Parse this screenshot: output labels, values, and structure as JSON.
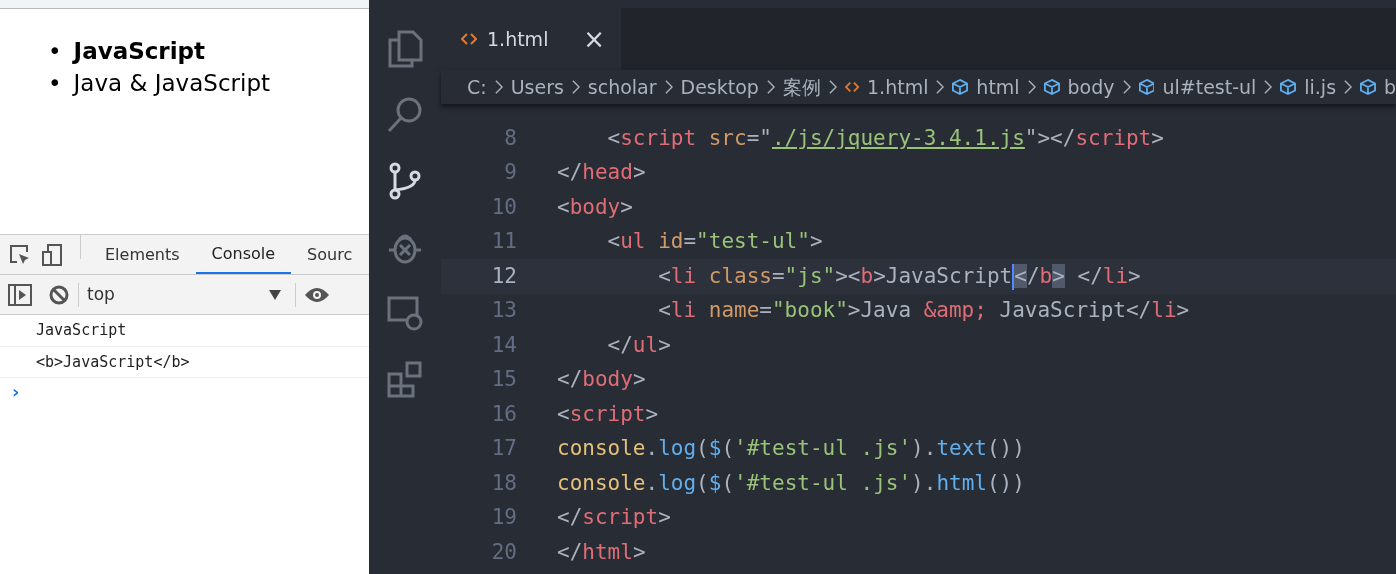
{
  "browser_page": {
    "list_items": [
      {
        "marker": "•",
        "text": "JavaScript",
        "bold": true
      },
      {
        "marker": "•",
        "text": "Java & JavaScript",
        "bold": false
      }
    ]
  },
  "devtools": {
    "tabs": [
      {
        "label": "Elements",
        "selected": false
      },
      {
        "label": "Console",
        "selected": true
      },
      {
        "label": "Sourc",
        "selected": false
      }
    ],
    "context": "top",
    "console_lines": [
      "JavaScript",
      "<b>JavaScript</b>"
    ],
    "prompt": "›"
  },
  "editor": {
    "tabs": [
      {
        "label": "1.html",
        "selected": true,
        "close": "×"
      }
    ],
    "breadcrumbs": [
      {
        "label": "C:",
        "kind": "folder"
      },
      {
        "label": "Users",
        "kind": "folder"
      },
      {
        "label": "scholar",
        "kind": "folder"
      },
      {
        "label": "Desktop",
        "kind": "folder"
      },
      {
        "label": "案例",
        "kind": "folder"
      },
      {
        "label": "1.html",
        "kind": "file"
      },
      {
        "label": "html",
        "kind": "element"
      },
      {
        "label": "body",
        "kind": "element"
      },
      {
        "label": "ul#test-ul",
        "kind": "element"
      },
      {
        "label": "li.js",
        "kind": "element"
      },
      {
        "label": "b",
        "kind": "element"
      }
    ],
    "lines": [
      {
        "number": "8",
        "current": false,
        "tokens": [
          {
            "kind": "punct",
            "text": "    <"
          },
          {
            "kind": "tag",
            "text": "script"
          },
          {
            "kind": "attr",
            "text": " src"
          },
          {
            "kind": "punct",
            "text": "=\""
          },
          {
            "kind": "link",
            "text": "./js/jquery-3.4.1.js"
          },
          {
            "kind": "punct",
            "text": "\"></"
          },
          {
            "kind": "tag",
            "text": "script"
          },
          {
            "kind": "punct",
            "text": ">"
          }
        ]
      },
      {
        "number": "9",
        "current": false,
        "tokens": [
          {
            "kind": "punct",
            "text": "</"
          },
          {
            "kind": "tag",
            "text": "head"
          },
          {
            "kind": "punct",
            "text": ">"
          }
        ]
      },
      {
        "number": "10",
        "current": false,
        "tokens": [
          {
            "kind": "punct",
            "text": "<"
          },
          {
            "kind": "tag",
            "text": "body"
          },
          {
            "kind": "punct",
            "text": ">"
          }
        ]
      },
      {
        "number": "11",
        "current": false,
        "tokens": [
          {
            "kind": "punct",
            "text": "    <"
          },
          {
            "kind": "tag",
            "text": "ul"
          },
          {
            "kind": "attr",
            "text": " id"
          },
          {
            "kind": "punct",
            "text": "="
          },
          {
            "kind": "string",
            "text": "\"test-ul\""
          },
          {
            "kind": "punct",
            "text": ">"
          }
        ]
      },
      {
        "number": "12",
        "current": true,
        "tokens": [
          {
            "kind": "punct",
            "text": "        <"
          },
          {
            "kind": "tag",
            "text": "li"
          },
          {
            "kind": "attr",
            "text": " class"
          },
          {
            "kind": "punct",
            "text": "="
          },
          {
            "kind": "string",
            "text": "\"js\""
          },
          {
            "kind": "punct",
            "text": "><"
          },
          {
            "kind": "tag",
            "text": "b"
          },
          {
            "kind": "punct",
            "text": ">JavaScript"
          },
          {
            "kind": "match",
            "text": "<"
          },
          {
            "kind": "punct",
            "text": "/"
          },
          {
            "kind": "tag",
            "text": "b"
          },
          {
            "kind": "match",
            "text": ">"
          },
          {
            "kind": "punct",
            "text": " </"
          },
          {
            "kind": "tag",
            "text": "li"
          },
          {
            "kind": "punct",
            "text": ">"
          }
        ]
      },
      {
        "number": "13",
        "current": false,
        "tokens": [
          {
            "kind": "punct",
            "text": "        <"
          },
          {
            "kind": "tag",
            "text": "li"
          },
          {
            "kind": "attr",
            "text": " name"
          },
          {
            "kind": "punct",
            "text": "="
          },
          {
            "kind": "string",
            "text": "\"book\""
          },
          {
            "kind": "punct",
            "text": ">Java "
          },
          {
            "kind": "tag",
            "text": "&amp;"
          },
          {
            "kind": "punct",
            "text": " JavaScript</"
          },
          {
            "kind": "tag",
            "text": "li"
          },
          {
            "kind": "punct",
            "text": ">"
          }
        ]
      },
      {
        "number": "14",
        "current": false,
        "tokens": [
          {
            "kind": "punct",
            "text": "    </"
          },
          {
            "kind": "tag",
            "text": "ul"
          },
          {
            "kind": "punct",
            "text": ">"
          }
        ]
      },
      {
        "number": "15",
        "current": false,
        "tokens": [
          {
            "kind": "punct",
            "text": "</"
          },
          {
            "kind": "tag",
            "text": "body"
          },
          {
            "kind": "punct",
            "text": ">"
          }
        ]
      },
      {
        "number": "16",
        "current": false,
        "tokens": [
          {
            "kind": "punct",
            "text": "<"
          },
          {
            "kind": "tag",
            "text": "script"
          },
          {
            "kind": "punct",
            "text": ">"
          }
        ]
      },
      {
        "number": "17",
        "current": false,
        "tokens": [
          {
            "kind": "object",
            "text": "console"
          },
          {
            "kind": "punct",
            "text": "."
          },
          {
            "kind": "func",
            "text": "log"
          },
          {
            "kind": "punct",
            "text": "("
          },
          {
            "kind": "func",
            "text": "$"
          },
          {
            "kind": "punct",
            "text": "("
          },
          {
            "kind": "string",
            "text": "'#test-ul .js'"
          },
          {
            "kind": "punct",
            "text": ")."
          },
          {
            "kind": "func",
            "text": "text"
          },
          {
            "kind": "punct",
            "text": "())"
          }
        ]
      },
      {
        "number": "18",
        "current": false,
        "tokens": [
          {
            "kind": "object",
            "text": "console"
          },
          {
            "kind": "punct",
            "text": "."
          },
          {
            "kind": "func",
            "text": "log"
          },
          {
            "kind": "punct",
            "text": "("
          },
          {
            "kind": "func",
            "text": "$"
          },
          {
            "kind": "punct",
            "text": "("
          },
          {
            "kind": "string",
            "text": "'#test-ul .js'"
          },
          {
            "kind": "punct",
            "text": ")."
          },
          {
            "kind": "func",
            "text": "html"
          },
          {
            "kind": "punct",
            "text": "())"
          }
        ]
      },
      {
        "number": "19",
        "current": false,
        "tokens": [
          {
            "kind": "punct",
            "text": "</"
          },
          {
            "kind": "tag",
            "text": "script"
          },
          {
            "kind": "punct",
            "text": ">"
          }
        ]
      },
      {
        "number": "20",
        "current": false,
        "tokens": [
          {
            "kind": "punct",
            "text": "</"
          },
          {
            "kind": "tag",
            "text": "html"
          },
          {
            "kind": "punct",
            "text": ">"
          }
        ]
      }
    ]
  }
}
